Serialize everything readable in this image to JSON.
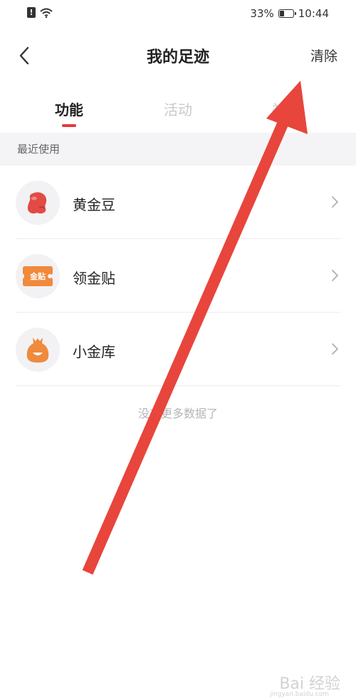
{
  "status_bar": {
    "battery_text": "33%",
    "battery_level": 0.33,
    "time": "10:44"
  },
  "nav": {
    "title": "我的足迹",
    "clear_label": "清除"
  },
  "tabs": [
    {
      "label": "功能",
      "active": true
    },
    {
      "label": "活动",
      "active": false
    },
    {
      "label": "社区",
      "active": false
    }
  ],
  "section": {
    "header": "最近使用"
  },
  "items": [
    {
      "label": "黄金豆",
      "icon": "gold-bean-icon"
    },
    {
      "label": "领金贴",
      "icon": "gold-coupon-icon",
      "icon_text": "金贴"
    },
    {
      "label": "小金库",
      "icon": "money-bag-icon"
    }
  ],
  "footer": {
    "no_more": "没有更多数据了"
  },
  "watermark": {
    "text": "Bai 经验",
    "sub": "jingyan.baidu.com"
  },
  "colors": {
    "accent": "#e4393c",
    "arrow": "#e8453c",
    "icon_orange": "#f08a3c",
    "icon_red": "#e24a45"
  }
}
